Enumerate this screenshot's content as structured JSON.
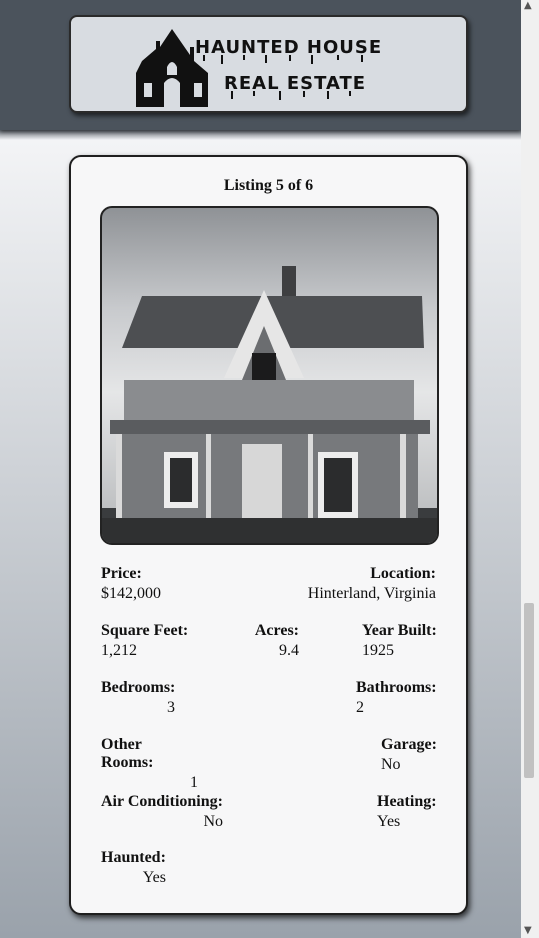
{
  "brand": {
    "line1": "HAUNTED HOUSE",
    "line2": "REAL ESTATE",
    "logo_icon": "haunted-house-icon"
  },
  "listing": {
    "title": "Listing 5 of 6",
    "photo_icon": "abandoned-house-photo",
    "fields": {
      "price": {
        "label": "Price:",
        "value": "$142,000"
      },
      "location": {
        "label": "Location:",
        "value": "Hinterland, Virginia"
      },
      "square_feet": {
        "label": "Square Feet:",
        "value": "1,212"
      },
      "acres": {
        "label": "Acres:",
        "value": "9.4"
      },
      "year_built": {
        "label": "Year Built:",
        "value": "1925"
      },
      "bedrooms": {
        "label": "Bedrooms:",
        "value": "3"
      },
      "bathrooms": {
        "label": "Bathrooms:",
        "value": "2"
      },
      "other_rooms": {
        "label": "Other Rooms:",
        "value": "1"
      },
      "garage": {
        "label": "Garage:",
        "value": "No"
      },
      "air_conditioning": {
        "label": "Air Conditioning:",
        "value": "No"
      },
      "heating": {
        "label": "Heating:",
        "value": "Yes"
      },
      "haunted": {
        "label": "Haunted:",
        "value": "Yes"
      }
    }
  },
  "colors": {
    "header_bg": "#4b535c",
    "card_bg": "#f7f7f8",
    "logo_bg": "#d8dce1"
  }
}
